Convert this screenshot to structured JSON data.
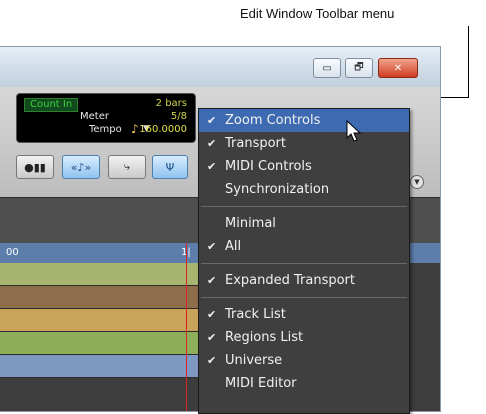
{
  "callout": {
    "label": "Edit Window Toolbar menu"
  },
  "titlebar": {
    "minimize": "▭",
    "restore": "🗗",
    "close": "✕"
  },
  "counter": {
    "count_in": "Count In",
    "bars": "2 bars",
    "meter_label": "Meter",
    "meter_value": "5/8",
    "tempo_label": "Tempo",
    "tempo_value": "160.0000"
  },
  "ruler": {
    "left_tick": "00",
    "right_tick": "1|"
  },
  "tracks": [
    "#a7b571",
    "#8e6d4b",
    "#c9a35a",
    "#8fae5a",
    "#7f98c2"
  ],
  "menu": {
    "items": [
      {
        "label": "Zoom Controls",
        "checked": true,
        "highlighted": true
      },
      {
        "label": "Transport",
        "checked": true
      },
      {
        "label": "MIDI Controls",
        "checked": true
      },
      {
        "label": "Synchronization",
        "checked": false
      },
      {
        "sep": true
      },
      {
        "label": "Minimal",
        "checked": false
      },
      {
        "label": "All",
        "checked": true
      },
      {
        "sep": true
      },
      {
        "label": "Expanded Transport",
        "checked": true
      },
      {
        "sep": true
      },
      {
        "label": "Track List",
        "checked": true
      },
      {
        "label": "Regions List",
        "checked": true
      },
      {
        "label": "Universe",
        "checked": true
      },
      {
        "label": "MIDI Editor",
        "checked": false
      }
    ]
  },
  "colors": {
    "highlight": "#3e6ab1",
    "menu_bg": "#3f3f3f"
  }
}
